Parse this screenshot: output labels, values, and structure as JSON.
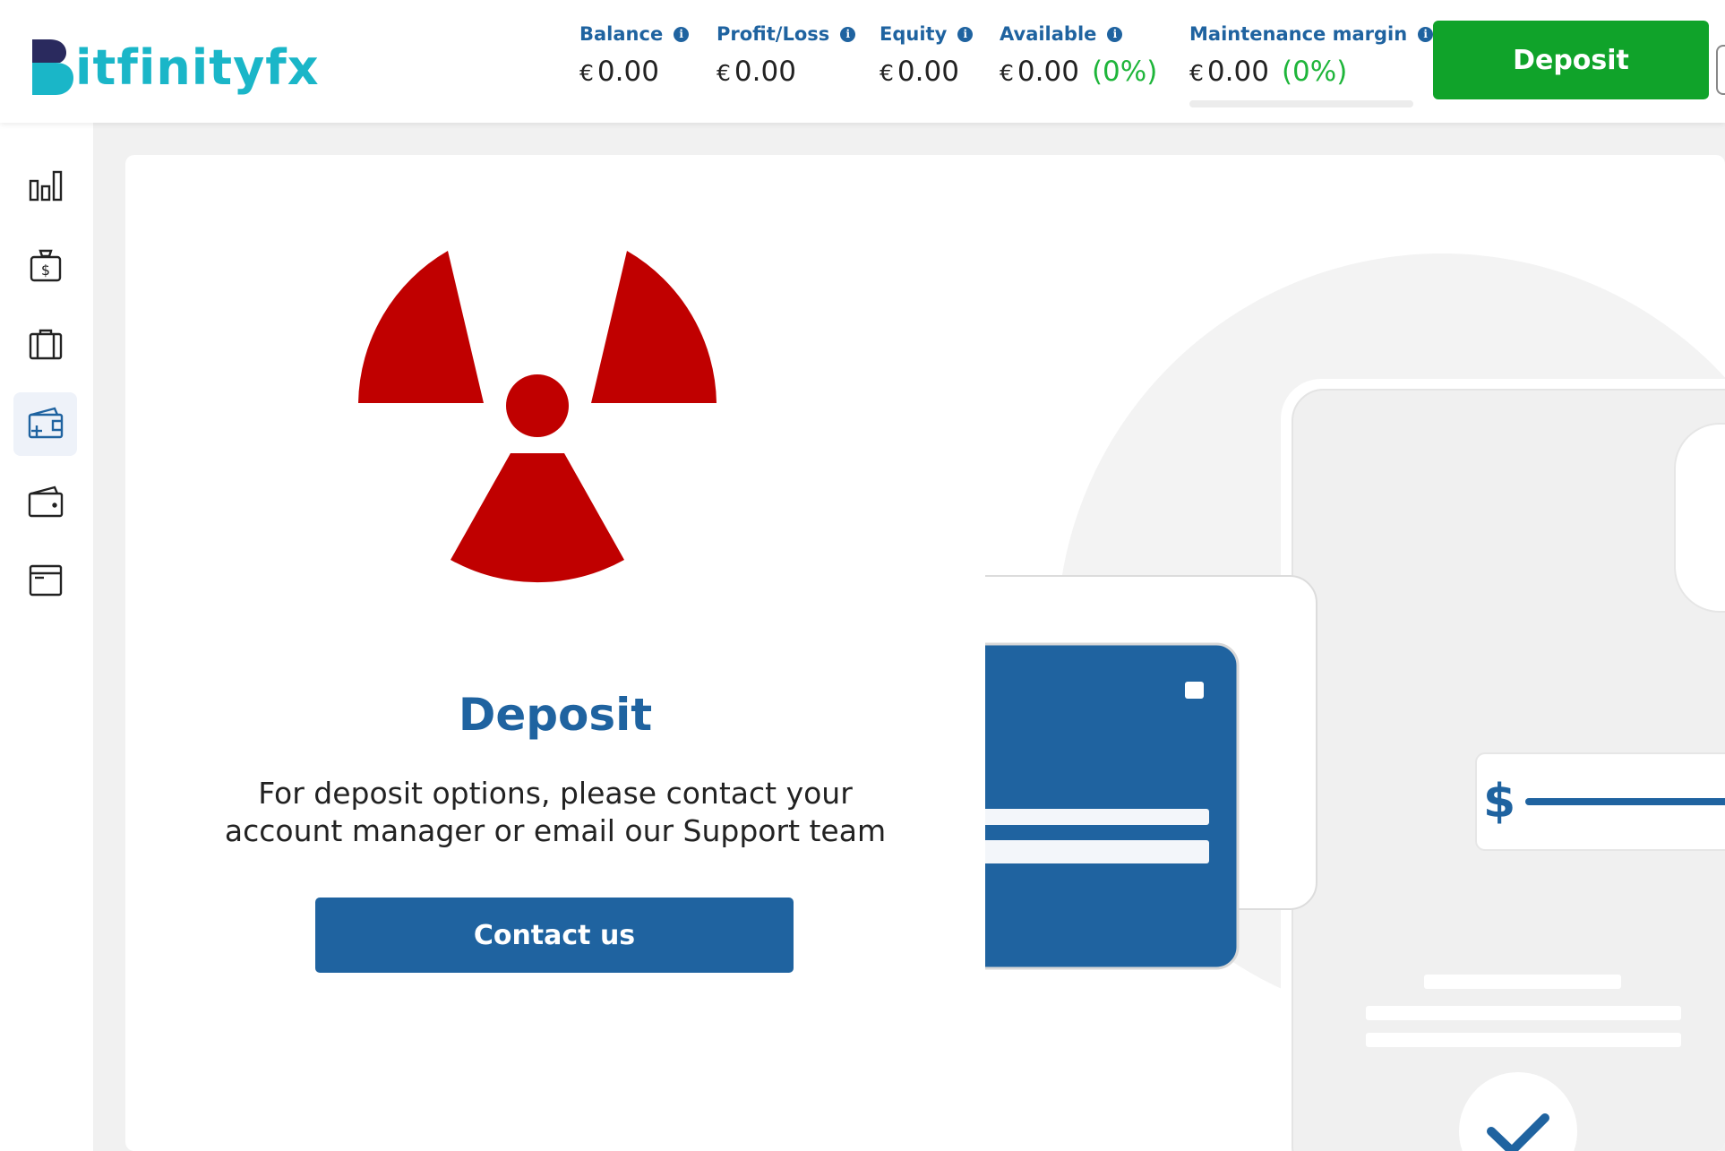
{
  "brand": {
    "name": "itfinityfx",
    "mark_letter": "B",
    "colors": {
      "primary": "#1f63a0",
      "teal": "#1ab6c8",
      "success": "#10a32a",
      "danger": "#c00000"
    }
  },
  "header": {
    "stats": [
      {
        "label": "Balance",
        "currency": "€",
        "value": "0.00",
        "pct": ""
      },
      {
        "label": "Profit/Loss",
        "currency": "€",
        "value": "0.00",
        "pct": ""
      },
      {
        "label": "Equity",
        "currency": "€",
        "value": "0.00",
        "pct": ""
      },
      {
        "label": "Available",
        "currency": "€",
        "value": "0.00",
        "pct": "(0%)"
      },
      {
        "label": "Maintenance margin",
        "currency": "€",
        "value": "0.00",
        "pct": "(0%)"
      }
    ],
    "deposit_label": "Deposit"
  },
  "sidebar": {
    "items": [
      {
        "icon": "bar-chart-icon",
        "active": false
      },
      {
        "icon": "money-bag-icon",
        "active": false
      },
      {
        "icon": "briefcase-icon",
        "active": false
      },
      {
        "icon": "wallet-add-icon",
        "active": true
      },
      {
        "icon": "wallet-icon",
        "active": false
      },
      {
        "icon": "document-icon",
        "active": false
      }
    ]
  },
  "main": {
    "title": "Deposit",
    "description_line1": "For deposit options, please contact your",
    "description_line2": "account manager or email our Support team",
    "contact_label": "Contact us",
    "illustration": {
      "currency_symbol": "$"
    }
  }
}
